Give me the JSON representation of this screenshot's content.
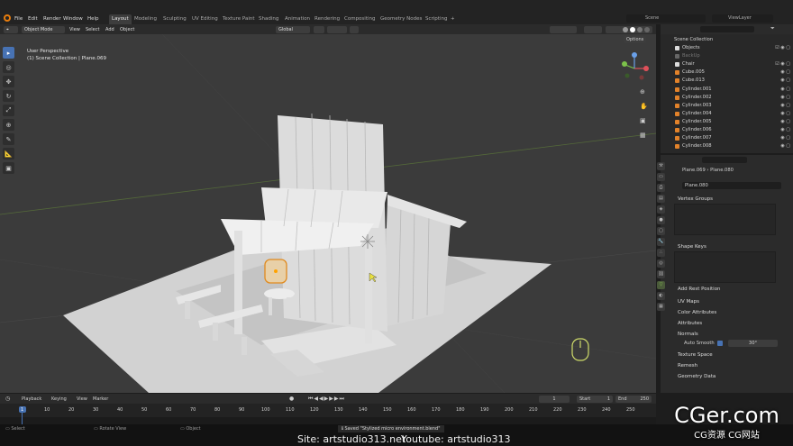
{
  "topmenu": [
    "File",
    "Edit",
    "Render",
    "Window",
    "Help"
  ],
  "workspaces": [
    "Layout",
    "Modeling",
    "Sculpting",
    "UV Editing",
    "Texture Paint",
    "Shading",
    "Animation",
    "Rendering",
    "Compositing",
    "Geometry Nodes",
    "Scripting"
  ],
  "scene": "Scene",
  "view_layer": "ViewLayer",
  "header3d": {
    "mode": "Object Mode",
    "view": "View",
    "select": "Select",
    "add": "Add",
    "object": "Object",
    "orientation": "Global",
    "options": "Options"
  },
  "viewport": {
    "perspective": "User Perspective",
    "collection": "(1) Scene Collection | Plane.069"
  },
  "outliner": {
    "root": "Scene Collection",
    "rows": [
      "Objects",
      "BackUp",
      "Chair",
      "Cube.005",
      "Cube.013",
      "Cylinder.001",
      "Cylinder.002",
      "Cylinder.003",
      "Cylinder.004",
      "Cylinder.005",
      "Cylinder.006",
      "Cylinder.007",
      "Cylinder.008"
    ]
  },
  "props": {
    "breadcrumb_obj": "Plane.069",
    "breadcrumb_mesh": "Plane.080",
    "mesh_name": "Plane.080",
    "vertex_groups": "Vertex Groups",
    "shape_keys": "Shape Keys",
    "add_rest": "Add Rest Position",
    "uv_maps": "UV Maps",
    "color_attr": "Color Attributes",
    "attributes": "Attributes",
    "normals": "Normals",
    "auto_smooth": "Auto Smooth",
    "angle": "30°",
    "texture_space": "Texture Space",
    "remesh": "Remesh",
    "geometry_data": "Geometry Data"
  },
  "timeline": {
    "playback": "Playback",
    "keying": "Keying",
    "view": "View",
    "marker": "Marker",
    "frame": "1",
    "start_label": "Start",
    "start": "1",
    "end_label": "End",
    "end": "250",
    "ticks": [
      "1",
      "10",
      "20",
      "30",
      "40",
      "50",
      "60",
      "70",
      "80",
      "90",
      "100",
      "110",
      "120",
      "130",
      "140",
      "150",
      "160",
      "170",
      "180",
      "190",
      "200",
      "210",
      "220",
      "230",
      "240",
      "250"
    ]
  },
  "status": {
    "select": "Select",
    "rotate": "Rotate View",
    "object": "Object",
    "saved": "Saved \"Stylized micro environment.blend\""
  },
  "watermark": {
    "site": "Site: artstudio313.net",
    "youtube": "Youtube: artstudio313",
    "brand": "CGer.com",
    "brand_sub": "CG资源 CG网站"
  }
}
